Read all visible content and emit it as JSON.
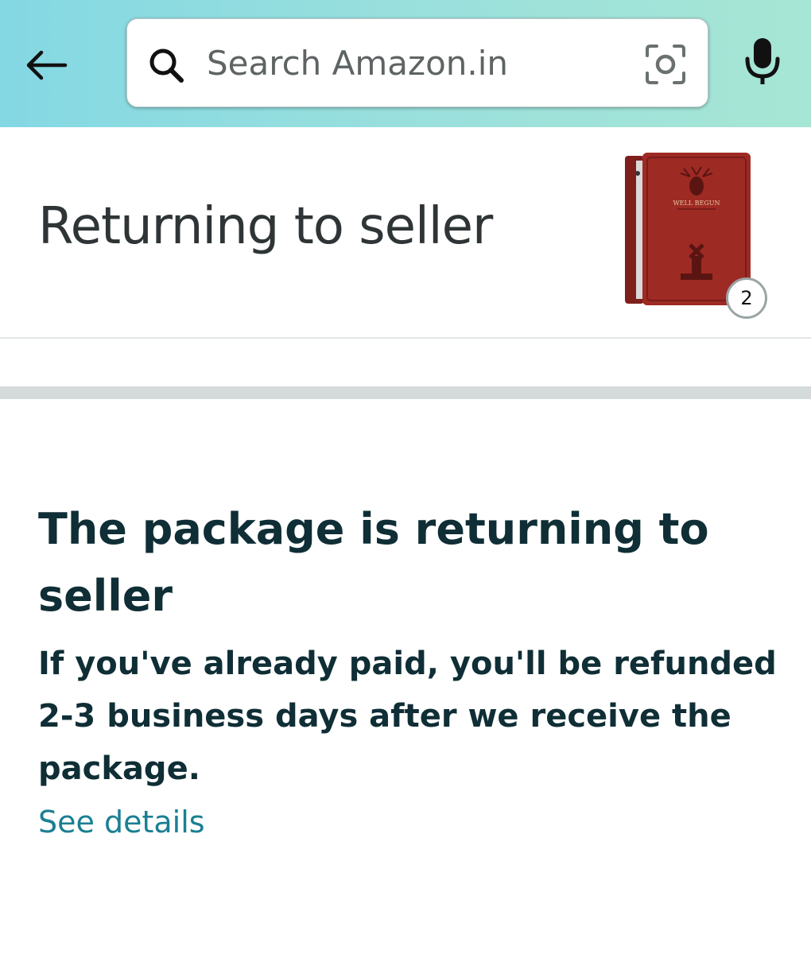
{
  "header": {
    "back_icon": "arrow-left-icon",
    "search": {
      "placeholder": "Search Amazon.in",
      "value": "",
      "search_icon": "search-icon",
      "camera_icon": "camera-icon"
    },
    "mic_icon": "microphone-icon",
    "gradient_colors": [
      "#84d8e3",
      "#a6e6d4"
    ]
  },
  "status": {
    "title": "Returning to seller",
    "item_count": "2",
    "thumbnail_description_icon": "tablet-case-thumbnail"
  },
  "message": {
    "heading": "The package is returning to seller",
    "body": "If you've already paid, you'll be refunded 2-3 business days after we receive the package.",
    "link_label": "See details",
    "link_color": "#1a7f93",
    "text_color": "#0f2e36"
  }
}
